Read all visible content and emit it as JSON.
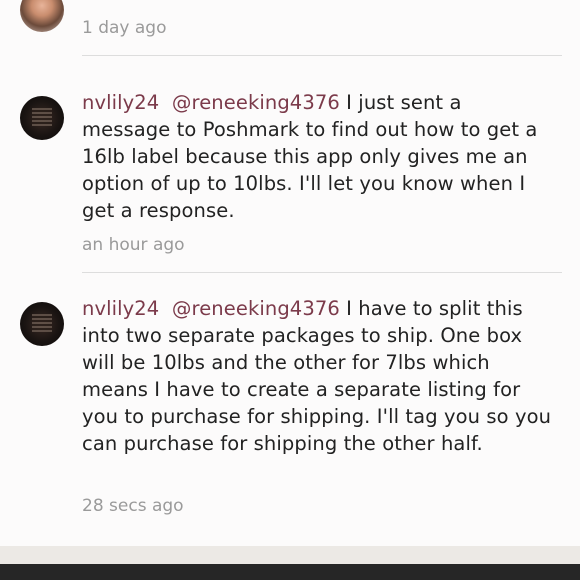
{
  "comments": [
    {
      "time": "1 day ago"
    },
    {
      "username": "nvlily24",
      "mention": "@reneeking4376",
      "body": "I just sent a message to Poshmark to find out how to get a 16lb label because this app only gives me an option of up to 10lbs.  I'll let you know when I get a response.",
      "time": "an hour ago"
    },
    {
      "username": "nvlily24",
      "mention": "@reneeking4376",
      "body": "I have to split this into two separate packages to ship.  One box will be 10lbs and the other for 7lbs which means I have to create a separate listing for you to purchase for shipping.  I'll tag you so you can purchase for shipping the other half.",
      "time": "28 secs ago"
    }
  ]
}
